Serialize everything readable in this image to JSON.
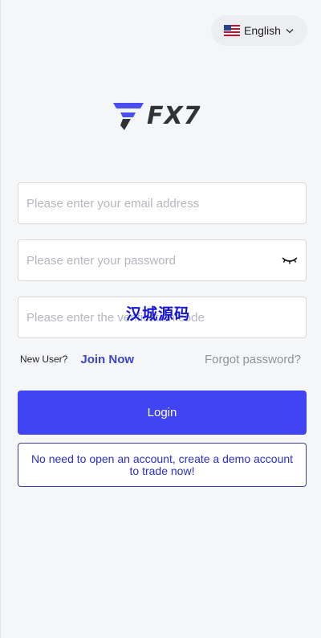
{
  "language": {
    "label": "English",
    "flag_icon": "us-flag-icon",
    "chevron_icon": "chevron-down-icon"
  },
  "brand": {
    "name": "FX7",
    "mark_icon": "fx7-logo-mark-icon",
    "colors": {
      "mark_blue": "#4b4ef0",
      "mark_dark": "#2f3236"
    }
  },
  "form": {
    "email_placeholder": "Please enter your email address",
    "password_placeholder": "Please enter your password",
    "password_toggle_icon": "eye-closed-icon",
    "code_placeholder": "Please enter the verification code"
  },
  "watermark": "汉城源码",
  "links": {
    "new_user": "New User?",
    "join_now": "Join Now",
    "forgot_password": "Forgot password?"
  },
  "buttons": {
    "login": "Login",
    "demo": "No need to open an account, create a demo account to trade now!"
  },
  "colors": {
    "primary": "#4144f3",
    "link": "#3d44c7",
    "page_background": "#f5f6f8"
  }
}
